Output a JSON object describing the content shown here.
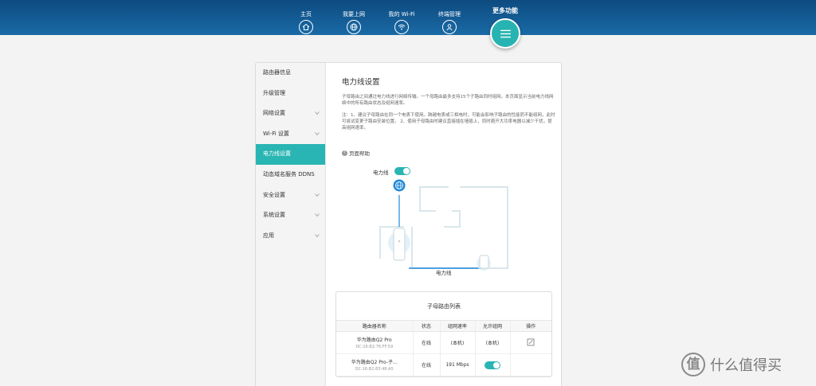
{
  "nav": {
    "items": [
      {
        "label": "主页",
        "icon": "home-icon"
      },
      {
        "label": "我要上网",
        "icon": "globe-icon"
      },
      {
        "label": "我的 Wi-Fi",
        "icon": "wifi-icon"
      },
      {
        "label": "终端管理",
        "icon": "user-icon"
      }
    ],
    "more_label": "更多功能",
    "more_icon": "menu-icon"
  },
  "sidebar": {
    "items": [
      {
        "label": "路由器信息",
        "expandable": false,
        "active": false
      },
      {
        "label": "升级管理",
        "expandable": false,
        "active": false
      },
      {
        "label": "网络设置",
        "expandable": true,
        "active": false
      },
      {
        "label": "Wi-Fi 设置",
        "expandable": true,
        "active": false
      },
      {
        "label": "电力线设置",
        "expandable": false,
        "active": true
      },
      {
        "label": "动态域名服务 DDNS",
        "expandable": false,
        "active": false
      },
      {
        "label": "安全设置",
        "expandable": true,
        "active": false
      },
      {
        "label": "系统设置",
        "expandable": true,
        "active": false
      },
      {
        "label": "应用",
        "expandable": true,
        "active": false
      }
    ]
  },
  "main": {
    "title": "电力线设置",
    "description": "子母路由之间通过电力线进行网络传输。一个母路由最多支持15个子路由同时组网。本页面显示当前电力线网络中的所有路由状态及组网速率。",
    "note": "注：1、建议子母路由在同一个电表下使用。跨越电表或三相电时，可能会影响子路由的性能而不能组网，此时可尝试变更子路由安装位置。 2、使用子母路由时建议直接插在墙插上，同时避开大功率电器以减少干扰，提高组网速率。",
    "help_label": "页面帮助",
    "plc_label": "电力线",
    "plc_enabled": true,
    "diagram_caption": "电力线"
  },
  "router_table": {
    "title": "子母路由列表",
    "columns": [
      "路由器名称",
      "状态",
      "组网速率",
      "允许组网",
      "操作"
    ],
    "rows": [
      {
        "name": "华为路由Q2 Pro",
        "mac": "DC:16:B2:76:FF:59",
        "status": "在线",
        "rate": "(本机)",
        "allow": "(本机)",
        "action": "edit-icon"
      },
      {
        "name": "华为路由Q2 Pro-子...",
        "mac": "DC:16:B2:83:48:A5",
        "status": "在线",
        "rate": "191 Mbps",
        "allow": "toggle-on",
        "action": ""
      }
    ]
  },
  "watermark": {
    "logo_char": "值",
    "text": "什么值得买"
  },
  "colors": {
    "topbar": "#124f86",
    "accent": "#29b5b3",
    "panel_bg": "#ffffff",
    "page_bg": "#f3f3f3"
  }
}
